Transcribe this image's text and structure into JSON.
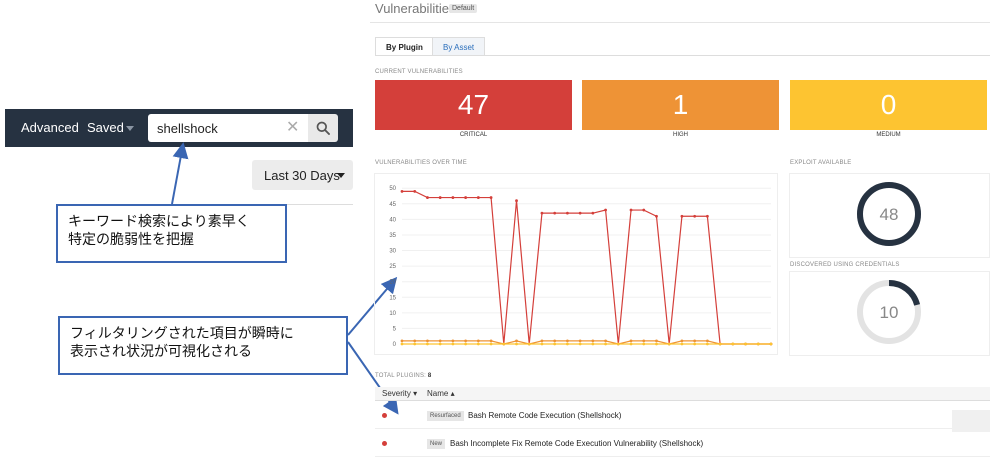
{
  "search_bar": {
    "advanced_label": "Advanced",
    "saved_label": "Saved",
    "query_value": "shellshock",
    "clear_icon": "close-icon",
    "search_icon": "search-icon"
  },
  "date_filter": {
    "label": "Last 30 Days"
  },
  "callouts": {
    "keyword_line1": "キーワード検索により素早く",
    "keyword_line2": "特定の脆弱性を把握",
    "filter_line1": "フィルタリングされた項目が瞬時に",
    "filter_line2": "表示され状況が可視化される"
  },
  "dashboard": {
    "title": "Vulnerabilities",
    "title_badge": "Default",
    "tabs": [
      {
        "label": "By Plugin",
        "active": true
      },
      {
        "label": "By Asset",
        "active": false
      }
    ],
    "current_label": "CURRENT VULNERABILITIES",
    "severity": [
      {
        "label": "CRITICAL",
        "count": "47",
        "color": "#d43f3a"
      },
      {
        "label": "HIGH",
        "count": "1",
        "color": "#ee9336"
      },
      {
        "label": "MEDIUM",
        "count": "0",
        "color": "#fdc431"
      }
    ],
    "over_time_label": "VULNERABILITIES OVER TIME",
    "exploit_label": "EXPLOIT AVAILABLE",
    "exploit_value": "48",
    "exploit_fraction": 1.0,
    "credentials_label": "DISCOVERED USING CREDENTIALS",
    "credentials_value": "10",
    "credentials_fraction": 0.21,
    "total_plugins_label": "TOTAL PLUGINS:",
    "total_plugins_value": "8",
    "table": {
      "col_severity": "Severity",
      "col_name": "Name",
      "rows": [
        {
          "badge": "Resurfaced",
          "name": "Bash Remote Code Execution (Shellshock)"
        },
        {
          "badge": "New",
          "name": "Bash Incomplete Fix Remote Code Execution Vulnerability (Shellshock)"
        }
      ]
    }
  },
  "chart_data": {
    "type": "line",
    "x": [
      1,
      2,
      3,
      4,
      5,
      6,
      7,
      8,
      9,
      10,
      11,
      12,
      13,
      14,
      15,
      16,
      17,
      18,
      19,
      20,
      21,
      22,
      23,
      24,
      25,
      26,
      27,
      28,
      29,
      30
    ],
    "series": [
      {
        "values": [
          49,
          49,
          47,
          47,
          47,
          47,
          47,
          47,
          0,
          46,
          0,
          42,
          42,
          42,
          42,
          42,
          43,
          0,
          43,
          43,
          41,
          0,
          41,
          41,
          41,
          0,
          0,
          0,
          0,
          0
        ],
        "color": "#d43f3a"
      },
      {
        "values": [
          1,
          1,
          1,
          1,
          1,
          1,
          1,
          1,
          0,
          1,
          0,
          1,
          1,
          1,
          1,
          1,
          1,
          0,
          1,
          1,
          1,
          0,
          1,
          1,
          1,
          0,
          0,
          0,
          0,
          0
        ],
        "color": "#ee9336"
      },
      {
        "values": [
          0,
          0,
          0,
          0,
          0,
          0,
          0,
          0,
          0,
          0,
          0,
          0,
          0,
          0,
          0,
          0,
          0,
          0,
          0,
          0,
          0,
          0,
          0,
          0,
          0,
          0,
          0,
          0,
          0,
          0
        ],
        "color": "#fdc431"
      }
    ],
    "y_ticks": [
      "0",
      "5",
      "10",
      "15",
      "20",
      "25",
      "30",
      "35",
      "40",
      "45",
      "50"
    ],
    "ylim": [
      0,
      52
    ],
    "grid": true
  }
}
